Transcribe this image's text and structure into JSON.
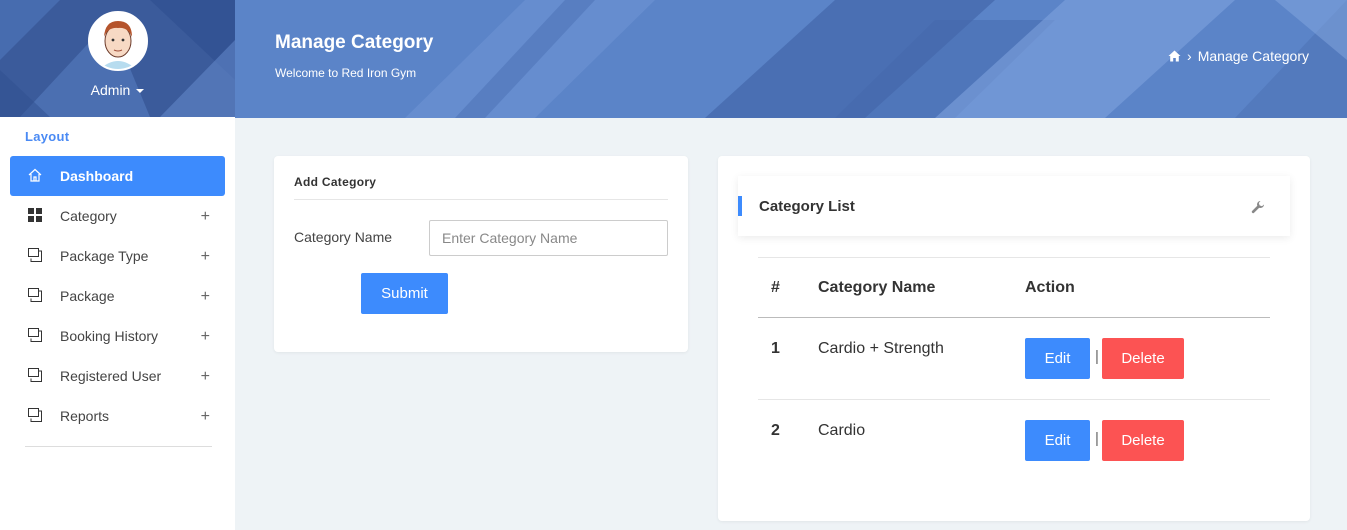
{
  "sidebar": {
    "profile": {
      "name": "Admin"
    },
    "section_title": "Layout",
    "items": [
      {
        "label": "Dashboard",
        "icon": "home-icon",
        "active": true
      },
      {
        "label": "Category",
        "icon": "grid-icon",
        "expand": "+"
      },
      {
        "label": "Package Type",
        "icon": "window-icon",
        "expand": "+"
      },
      {
        "label": "Package",
        "icon": "window-icon",
        "expand": "+"
      },
      {
        "label": "Booking History",
        "icon": "window-icon",
        "expand": "+"
      },
      {
        "label": "Registered User",
        "icon": "window-icon",
        "expand": "+"
      },
      {
        "label": "Reports",
        "icon": "window-icon",
        "expand": "+"
      }
    ]
  },
  "header": {
    "title": "Manage Category",
    "subtitle": "Welcome to Red Iron Gym",
    "breadcrumb": {
      "current": "Manage Category",
      "separator": "›"
    }
  },
  "add_form": {
    "title": "Add Category",
    "label": "Category Name",
    "placeholder": "Enter Category Name",
    "value": "",
    "submit_label": "Submit"
  },
  "list": {
    "title": "Category List",
    "columns": [
      "#",
      "Category Name",
      "Action"
    ],
    "rows": [
      {
        "num": "1",
        "name": "Cardio + Strength",
        "edit": "Edit",
        "sep": "|",
        "delete": "Delete"
      },
      {
        "num": "2",
        "name": "Cardio",
        "edit": "Edit",
        "sep": "|",
        "delete": "Delete"
      }
    ]
  },
  "colors": {
    "primary": "#3d8bfd",
    "danger": "#fc5353",
    "header_bg": "#5b84c8",
    "page_bg": "#eef3f6"
  }
}
